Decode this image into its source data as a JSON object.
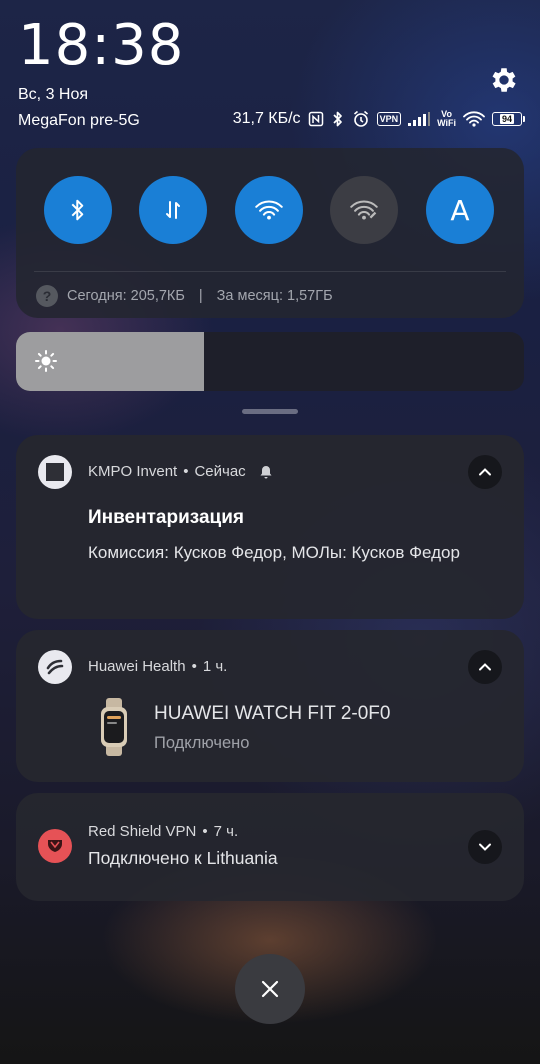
{
  "status": {
    "time": "18:38",
    "date": "Вс, 3 Ноя",
    "carrier": "MegaFon pre-5G",
    "network_speed": "31,7 КБ/с",
    "vpn_label": "VPN",
    "volte_top": "Vo",
    "volte_bottom": "WiFi",
    "battery": "94"
  },
  "quick_settings": {
    "tiles": [
      {
        "name": "bluetooth",
        "state": "on"
      },
      {
        "name": "mobile-data",
        "state": "on"
      },
      {
        "name": "wifi",
        "state": "on"
      },
      {
        "name": "wifi-hotspot",
        "state": "off"
      },
      {
        "name": "auto-brightness",
        "state": "on",
        "label": "A"
      }
    ],
    "data_usage": {
      "today": "Сегодня: 205,7КБ",
      "separator": "|",
      "month": "За месяц: 1,57ГБ"
    }
  },
  "brightness": {
    "level": 0.37
  },
  "notifications": [
    {
      "app": "KMPO Invent",
      "time": "Сейчас",
      "title": "Инвентаризация",
      "text": "Комиссия: Кусков Федор, МОЛы: Кусков Федор",
      "expanded": true
    },
    {
      "app": "Huawei Health",
      "time": "1 ч.",
      "device": "HUAWEI WATCH FIT 2-0F0",
      "device_status": "Подключено",
      "expanded": true
    },
    {
      "app": "Red Shield VPN",
      "time": "7 ч.",
      "text": "Подключено к Lithuania",
      "expanded": false
    }
  ],
  "colors": {
    "accent": "#1a7fd6",
    "tile_off": "#3c3d44",
    "vpn_icon": "#e04848",
    "card": "#26272e"
  }
}
